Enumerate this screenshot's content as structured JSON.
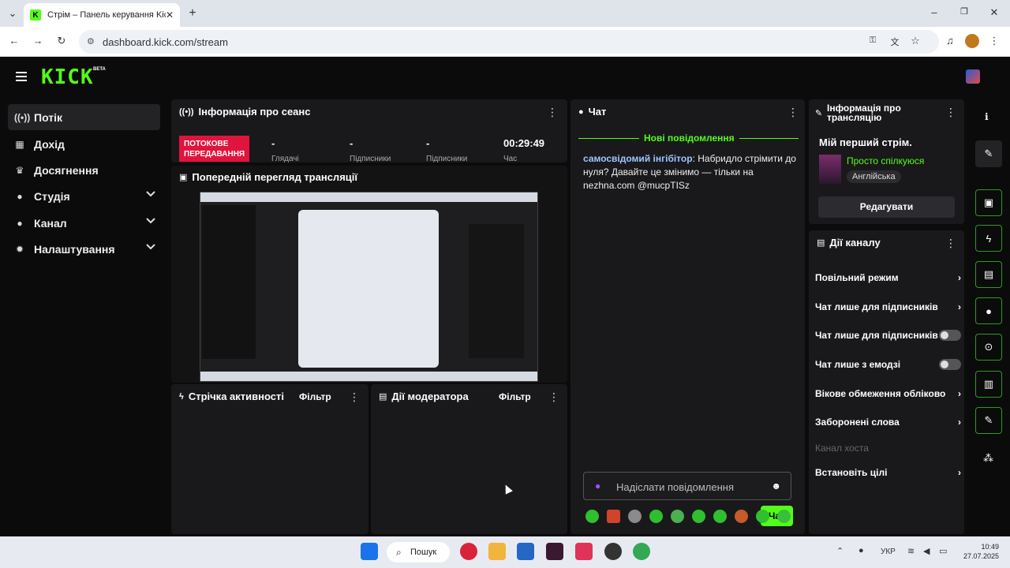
{
  "browser": {
    "tab_title": "Стрім – Панель керування Kic",
    "url": "dashboard.kick.com/stream"
  },
  "app": {
    "logo": "KICK",
    "logo_badge": "BETA"
  },
  "sidebar": {
    "items": [
      {
        "label": "Потік",
        "icon": "broadcast-icon"
      },
      {
        "label": "Дохід",
        "icon": "chart-icon"
      },
      {
        "label": "Досягнення",
        "icon": "trophy-icon"
      },
      {
        "label": "Студія",
        "icon": "mic-icon"
      },
      {
        "label": "Канал",
        "icon": "person-icon"
      },
      {
        "label": "Налаштування",
        "icon": "gear-icon"
      }
    ]
  },
  "session": {
    "title": "Інформація про сеанс",
    "status": "ПОТОКОВЕ ПЕРЕДАВАННЯ",
    "stat1": "-",
    "stat2": "-",
    "stat3": "-",
    "time": "00:29:49",
    "label1": "Глядачі",
    "label2": "Підписники",
    "label3": "Підписники",
    "label4": "Час"
  },
  "preview": {
    "title": "Попередній перегляд трансляції"
  },
  "activity": {
    "title": "Стрічка активності",
    "filter": "Фільтр"
  },
  "moderator": {
    "title": "Дії модератора",
    "filter": "Фільтр"
  },
  "chat": {
    "title": "Чат",
    "new_messages": "Нові повідомлення",
    "message_user": "самосвідомий інгібітор",
    "message_text": ": Набридло стрімити до нуля? Давайте це змінимо — тільки на nezhna.com @mucpTISz",
    "input_placeholder": "Надіслати повідомлення",
    "send_label": "Чат"
  },
  "stream_info": {
    "title": "Інформація про трансляцію",
    "stream_title": "Мій перший стрім.",
    "category": "Просто спілкуюся",
    "language": "Англійська",
    "edit_label": "Редагувати"
  },
  "channel_actions": {
    "title": "Дії каналу",
    "items": [
      {
        "label": "Повільний режим"
      },
      {
        "label": "Чат лише для підписників"
      },
      {
        "label": "Чат лише для підписників"
      },
      {
        "label": "Чат лише з емодзі"
      },
      {
        "label": "Вікове обмеження обліково"
      },
      {
        "label": "Заборонені слова"
      }
    ],
    "host_label": "Канал хоста",
    "goals_label": "Встановіть цілі"
  },
  "taskbar": {
    "search_label": "Пошук",
    "lang": "УКР",
    "time": "10:49",
    "date": "27.07.2025"
  },
  "colors": {
    "accent": "#53fc18",
    "live": "#e0143c",
    "panel": "#19191b"
  }
}
